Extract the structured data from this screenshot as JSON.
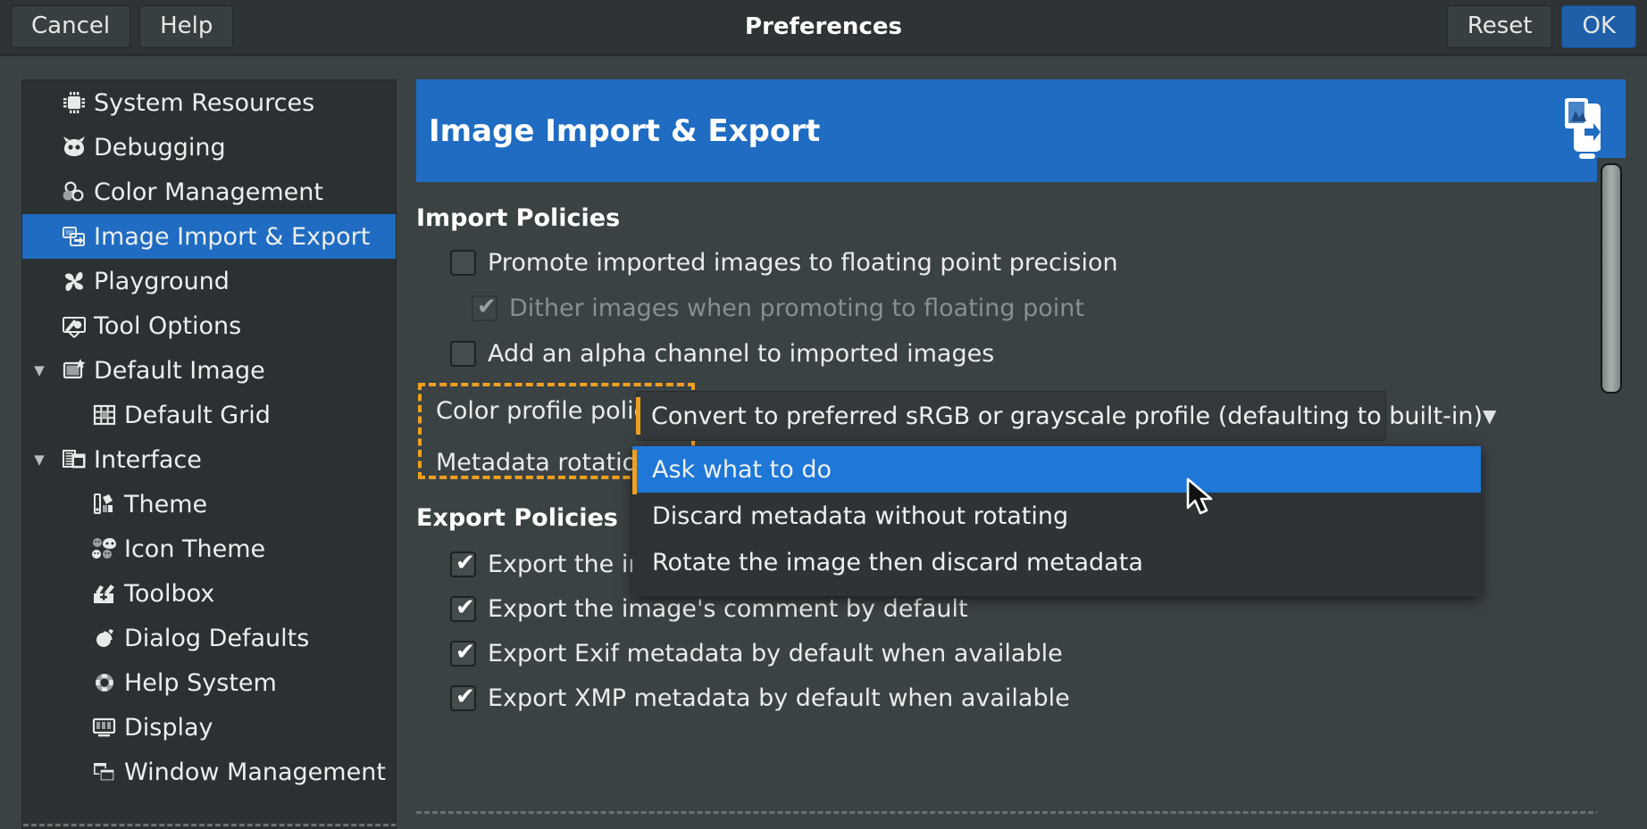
{
  "titlebar": {
    "title": "Preferences",
    "cancel_label": "Cancel",
    "help_label": "Help",
    "reset_label": "Reset",
    "ok_label": "OK"
  },
  "colors": {
    "accent_blue": "#1f6cc2",
    "popup_highlight": "#1f77d8",
    "highlight_dashed": "#f0a020",
    "window_bg": "#3b4244",
    "sidebar_bg": "#2b3032",
    "titlebar_bg": "#2e3436"
  },
  "sidebar": {
    "items": [
      {
        "label": "System Resources",
        "icon": "cpu-chip-icon",
        "indent": 1,
        "expander": "",
        "selected": false
      },
      {
        "label": "Debugging",
        "icon": "wilber-face-icon",
        "indent": 1,
        "expander": "",
        "selected": false
      },
      {
        "label": "Color Management",
        "icon": "color-circles-icon",
        "indent": 1,
        "expander": "",
        "selected": false
      },
      {
        "label": "Image Import & Export",
        "icon": "image-import-export-icon",
        "indent": 1,
        "expander": "",
        "selected": true
      },
      {
        "label": "Playground",
        "icon": "pinwheel-icon",
        "indent": 1,
        "expander": "",
        "selected": false
      },
      {
        "label": "Tool Options",
        "icon": "tool-options-icon",
        "indent": 1,
        "expander": "",
        "selected": false
      },
      {
        "label": "Default Image",
        "icon": "default-image-icon",
        "indent": 0,
        "expander": "▼",
        "selected": false
      },
      {
        "label": "Default Grid",
        "icon": "grid-icon",
        "indent": 2,
        "expander": "",
        "selected": false
      },
      {
        "label": "Interface",
        "icon": "interface-windows-icon",
        "indent": 0,
        "expander": "▼",
        "selected": false
      },
      {
        "label": "Theme",
        "icon": "theme-palette-icon",
        "indent": 2,
        "expander": "",
        "selected": false
      },
      {
        "label": "Icon Theme",
        "icon": "icon-theme-faces-icon",
        "indent": 2,
        "expander": "",
        "selected": false
      },
      {
        "label": "Toolbox",
        "icon": "toolbox-icon",
        "indent": 2,
        "expander": "",
        "selected": false
      },
      {
        "label": "Dialog Defaults",
        "icon": "dialog-defaults-icon",
        "indent": 2,
        "expander": "",
        "selected": false
      },
      {
        "label": "Help System",
        "icon": "life-ring-icon",
        "indent": 2,
        "expander": "",
        "selected": false
      },
      {
        "label": "Display",
        "icon": "monitor-icon",
        "indent": 2,
        "expander": "",
        "selected": false
      },
      {
        "label": "Window Management",
        "icon": "window-management-icon",
        "indent": 2,
        "expander": "",
        "selected": false
      }
    ]
  },
  "page": {
    "header_title": "Image Import & Export",
    "header_icon": "image-import-export-large-icon",
    "import_section_title": "Import Policies",
    "export_section_title": "Export Policies",
    "import_checkboxes": [
      {
        "label": "Promote imported images to floating point precision",
        "checked": false,
        "disabled": false
      },
      {
        "label": "Dither images when promoting to floating point",
        "checked": true,
        "disabled": true
      },
      {
        "label": "Add an alpha channel to imported images",
        "checked": false,
        "disabled": false
      }
    ],
    "color_profile_policy_label": "Color profile policy:",
    "color_profile_policy_value": "Convert to preferred sRGB or grayscale profile (defaulting to built-in)",
    "metadata_rotation_policy_label": "Metadata rotation policy:",
    "dropdown_arrow": "▼",
    "metadata_rotation_options": [
      {
        "label": "Ask what to do",
        "selected": true
      },
      {
        "label": "Discard metadata without rotating",
        "selected": false
      },
      {
        "label": "Rotate the image then discard metadata",
        "selected": false
      }
    ],
    "export_checkboxes": [
      {
        "label": "Export the image's color profile by default",
        "checked": true
      },
      {
        "label": "Export the image's comment by default",
        "checked": true
      },
      {
        "label": "Export Exif metadata by default when available",
        "checked": true
      },
      {
        "label": "Export XMP metadata by default when available",
        "checked": true
      }
    ],
    "checkmark_glyph": "✔"
  }
}
